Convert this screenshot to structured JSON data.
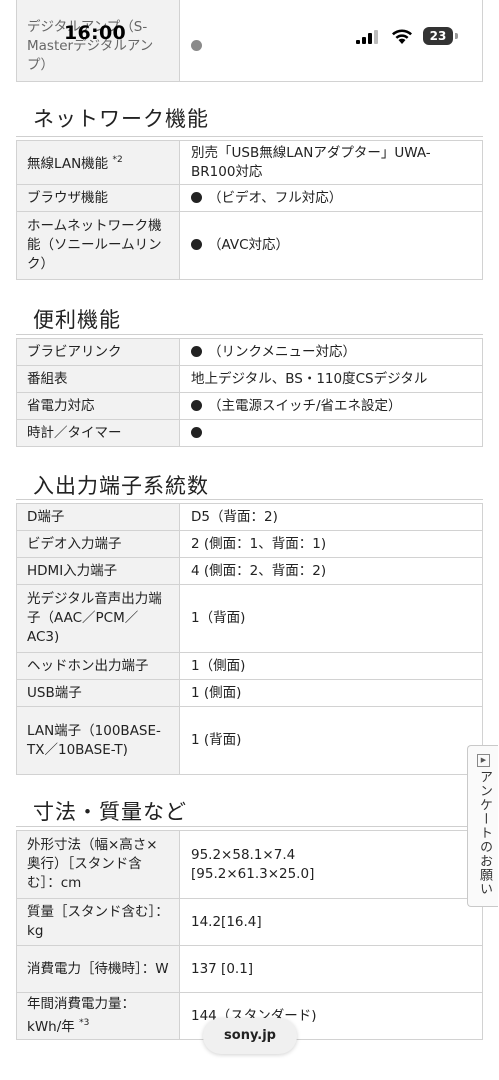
{
  "status_bar": {
    "time": "16:00",
    "battery": "23"
  },
  "sections": {
    "top_row": {
      "label": "デジタルアンプ（S-Masterデジタルアンプ）"
    },
    "network": {
      "title": "ネットワーク機能",
      "rows": [
        {
          "label": "無線LAN機能",
          "note": "*2",
          "value": "別売「USB無線LANアダプター」UWA-BR100対応"
        },
        {
          "label": "ブラウザ機能",
          "value": "（ビデオ、フル対応）"
        },
        {
          "label": "ホームネットワーク機能（ソニールームリンク）",
          "value": "（AVC対応）"
        }
      ]
    },
    "convenience": {
      "title": "便利機能",
      "rows": [
        {
          "label": "ブラビアリンク",
          "value": "（リンクメニュー対応）"
        },
        {
          "label": "番組表",
          "value": "地上デジタル、BS・110度CSデジタル"
        },
        {
          "label": "省電力対応",
          "value": "（主電源スイッチ/省エネ設定）"
        },
        {
          "label": "時計／タイマー",
          "value": ""
        }
      ]
    },
    "io": {
      "title": "入出力端子系統数",
      "rows": [
        {
          "label": "D端子",
          "value": "D5（背面：2)"
        },
        {
          "label": "ビデオ入力端子",
          "value": "2 (側面：1、背面：1)"
        },
        {
          "label": "HDMI入力端子",
          "value": "4 (側面：2、背面：2)"
        },
        {
          "label": "光デジタル音声出力端子（AAC／PCM／AC3)",
          "value": "1（背面)"
        },
        {
          "label": "ヘッドホン出力端子",
          "value": "1（側面)"
        },
        {
          "label": "USB端子",
          "value": "1 (側面)"
        },
        {
          "label": "LAN端子（100BASE-TX／10BASE-T)",
          "value": "1 (背面)"
        }
      ]
    },
    "dimensions": {
      "title": "寸法・質量など",
      "rows": [
        {
          "label": "外形寸法（幅×高さ×奥行）［スタンド含む］：cm",
          "value": "95.2×58.1×7.4",
          "value2": "[95.2×61.3×25.0]"
        },
        {
          "label": "質量［スタンド含む］：kg",
          "value": "14.2[16.4]"
        },
        {
          "label": "消費電力［待機時］：W",
          "value": "137 [0.1]"
        },
        {
          "label": "年間消費電力量：kWh/年",
          "note": "*3",
          "value": "144（スタンダード)"
        }
      ]
    }
  },
  "survey_tab": {
    "label": "アンケートのお願い"
  },
  "url_bar": {
    "domain": "sony.jp"
  }
}
